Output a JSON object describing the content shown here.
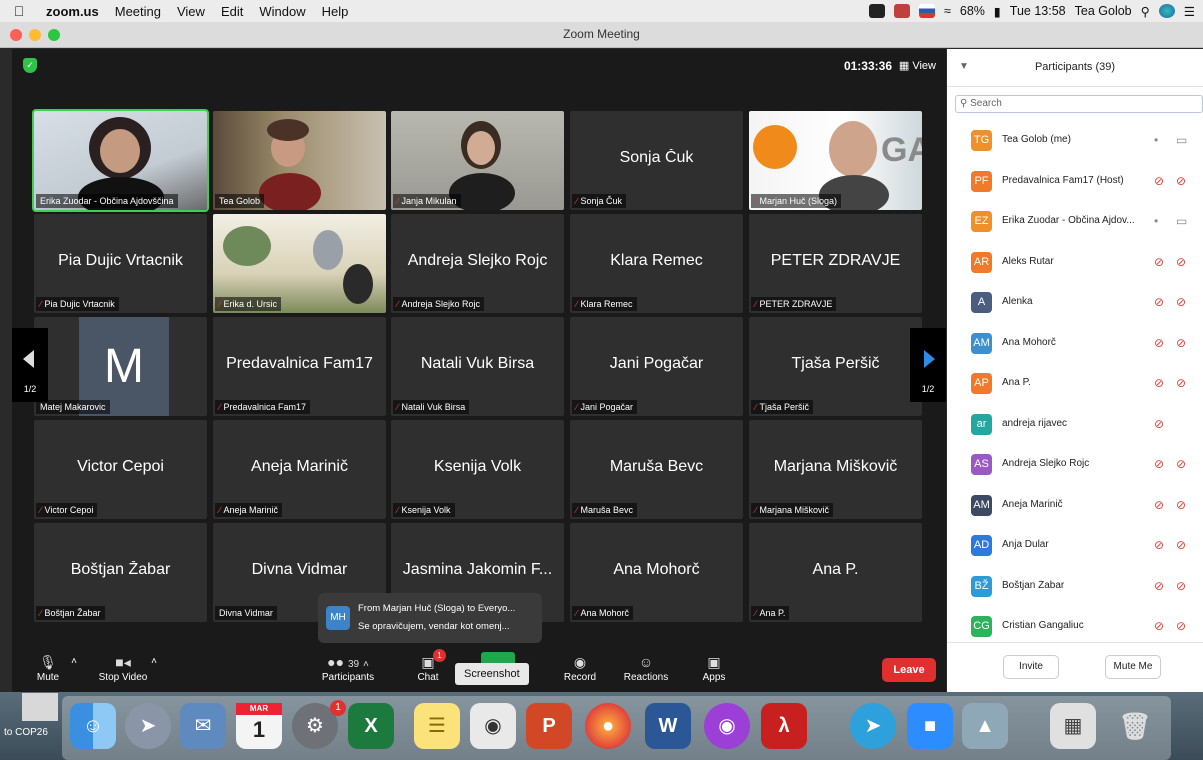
{
  "menubar": {
    "app": "zoom.us",
    "items": [
      "Meeting",
      "View",
      "Edit",
      "Window",
      "Help"
    ],
    "battery": "68%",
    "clock": "Tue 13:58",
    "user": "Tea Golob"
  },
  "window": {
    "title": "Zoom Meeting"
  },
  "meeting": {
    "timer": "01:33:36",
    "view_label": "View",
    "page_left": "1/2",
    "page_right": "1/2"
  },
  "tiles": [
    {
      "big": "",
      "label": "Erika Zuodar - Občina Ajdovščina",
      "video": true,
      "active": true
    },
    {
      "big": "",
      "label": "Tea Golob",
      "video": true
    },
    {
      "big": "",
      "label": "Janja Mikulan",
      "video": true,
      "muted": true
    },
    {
      "big": "Sonja Čuk",
      "label": "Sonja Čuk",
      "muted": true
    },
    {
      "big": "",
      "label": "Marjan Huč (Sloga)",
      "video": true,
      "muted": true
    },
    {
      "big": "Pia Dujic Vrtacnik",
      "label": "Pia Dujic Vrtacnik",
      "muted": true
    },
    {
      "big": "",
      "label": "Erika d. Ursic",
      "video": true,
      "muted": true
    },
    {
      "big": "Andreja Slejko Rojc",
      "label": "Andreja Slejko Rojc",
      "muted": true
    },
    {
      "big": "Klara Remec",
      "label": "Klara Remec",
      "muted": true
    },
    {
      "big": "PETER ZDRAVJE",
      "label": "PETER ZDRAVJE",
      "muted": true
    },
    {
      "big": "M",
      "label": "Matej Makarovic",
      "letter": true
    },
    {
      "big": "Predavalnica Fam17",
      "label": "Predavalnica Fam17",
      "muted": true
    },
    {
      "big": "Natali Vuk Birsa",
      "label": "Natali Vuk Birsa",
      "muted": true
    },
    {
      "big": "Jani Pogačar",
      "label": "Jani Pogačar",
      "muted": true
    },
    {
      "big": "Tjaša Peršič",
      "label": "Tjaša Peršič",
      "muted": true
    },
    {
      "big": "Victor Cepoi",
      "label": "Victor Cepoi",
      "muted": true
    },
    {
      "big": "Aneja Marinič",
      "label": "Aneja Marinič",
      "muted": true
    },
    {
      "big": "Ksenija Volk",
      "label": "Ksenija Volk",
      "muted": true
    },
    {
      "big": "Maruša Bevc",
      "label": "Maruša Bevc",
      "muted": true
    },
    {
      "big": "Marjana Miškovič",
      "label": "Marjana Miškovič",
      "muted": true
    },
    {
      "big": "Boštjan Žabar",
      "label": "Boštjan Žabar",
      "muted": true
    },
    {
      "big": "Divna Vidmar",
      "label": "Divna Vidmar"
    },
    {
      "big": "Jasmina Jakomin F...",
      "label": ""
    },
    {
      "big": "Ana Mohorč",
      "label": "Ana Mohorč",
      "muted": true
    },
    {
      "big": "Ana P.",
      "label": "Ana P.",
      "muted": true
    }
  ],
  "chat_popup": {
    "initials": "MH",
    "line1": "From Marjan Huč (Sloga) to Everyo...",
    "line2": "Se opravičujem, vendar kot omenj..."
  },
  "toolbar": {
    "mute": "Mute",
    "video": "Stop Video",
    "participants": "Participants",
    "participants_count": "39",
    "chat": "Chat",
    "chat_badge": "1",
    "screenshot_tip": "Screenshot",
    "record": "Record",
    "reactions": "Reactions",
    "apps": "Apps",
    "leave": "Leave"
  },
  "panel": {
    "title": "Participants (39)",
    "search_placeholder": "Search",
    "invite": "Invite",
    "mute_me": "Mute Me",
    "participants": [
      {
        "initials": "TG",
        "name": "Tea Golob (me)",
        "color": "#f0902a",
        "mic": "on",
        "cam": "on"
      },
      {
        "initials": "PF",
        "name": "Predavalnica Fam17 (Host)",
        "color": "#f07a2a",
        "mic": "off",
        "cam": "off"
      },
      {
        "initials": "EZ",
        "name": "Erika Zuodar - Občina Ajdov...",
        "color": "#f0902a",
        "mic": "on",
        "cam": "on"
      },
      {
        "initials": "AR",
        "name": "Aleks Rutar",
        "color": "#f07a2a",
        "mic": "off",
        "cam": "off"
      },
      {
        "initials": "A",
        "name": "Alenka",
        "color": "#4a5e80",
        "mic": "off",
        "cam": "off"
      },
      {
        "initials": "AM",
        "name": "Ana Mohorč",
        "color": "#3d8fd0",
        "mic": "off",
        "cam": "off"
      },
      {
        "initials": "AP",
        "name": "Ana P.",
        "color": "#f07a2a",
        "mic": "off",
        "cam": "off"
      },
      {
        "initials": "ar",
        "name": "andreja rijavec",
        "color": "#22a8a0",
        "mic": "off",
        "cam": "none"
      },
      {
        "initials": "AS",
        "name": "Andreja Slejko Rojc",
        "color": "#9b59c6",
        "mic": "off",
        "cam": "off"
      },
      {
        "initials": "AM",
        "name": "Aneja Marinič",
        "color": "#3c4a63",
        "mic": "off",
        "cam": "off"
      },
      {
        "initials": "AD",
        "name": "Anja Dular",
        "color": "#2e7ad8",
        "mic": "off",
        "cam": "off"
      },
      {
        "initials": "BŽ",
        "name": "Boštjan Žabar",
        "color": "#2e9ad8",
        "mic": "off",
        "cam": "off"
      },
      {
        "initials": "CG",
        "name": "Cristian Gangaliuc",
        "color": "#2eb35c",
        "mic": "off",
        "cam": "off"
      }
    ]
  },
  "dock": {
    "calendar_month": "MAR",
    "calendar_day": "1",
    "settings_badge": "1",
    "desktop_label": "to COP26"
  }
}
